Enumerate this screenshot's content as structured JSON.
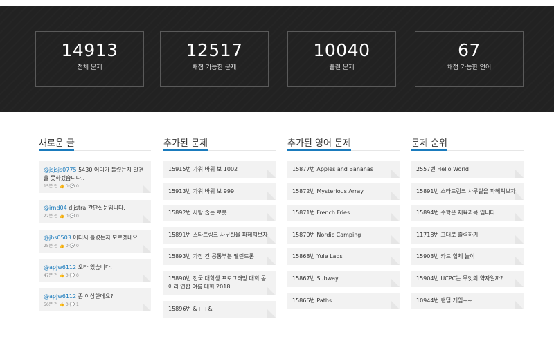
{
  "stats": [
    {
      "value": "14913",
      "label": "전체 문제"
    },
    {
      "value": "12517",
      "label": "채점 가능한 문제"
    },
    {
      "value": "10040",
      "label": "풀린 문제"
    },
    {
      "value": "67",
      "label": "채점 가능한 언어"
    }
  ],
  "new_posts": {
    "title": "새로운 글",
    "items": [
      {
        "user": "@jsjsjs0775",
        "text": " 5430 어디가 틀렸는지 발견을 못하겠습니다..",
        "meta": "15분 전 👍 0 💬 0"
      },
      {
        "user": "@irnd04",
        "text": " dijstra 간단질문입니다.",
        "meta": "22분 전 👍 0 💬 0"
      },
      {
        "user": "@jhs0503",
        "text": " 어디서 틀렸는지 모르겠네요",
        "meta": "25분 전 👍 0 💬 0"
      },
      {
        "user": "@apjw6112",
        "text": " 오타 있습니다.",
        "meta": "47분 전 👍 0 💬 0"
      },
      {
        "user": "@apjw6112",
        "text": " 좀 이상한데요?",
        "meta": "56분 전 👍 0 💬 1"
      }
    ]
  },
  "added_problems": {
    "title": "추가된 문제",
    "items": [
      "15915번 가위 바위 보 1002",
      "15913번 가위 바위 보 999",
      "15892번 사탕 줍는 로봇",
      "15891번 스타트링크 사무실을 파헤쳐보자",
      "15893번 가장 긴 공통부분 팰린드롬",
      "15890번 전국 대학생 프로그래밍 대회 동아리 연합 여름 대회 2018",
      "15896번 &+ +&"
    ]
  },
  "added_english": {
    "title": "추가된 영어 문제",
    "items": [
      "15877번 Apples and Bananas",
      "15872번 Mysterious Array",
      "15871번 French Fries",
      "15870번 Nordic Camping",
      "15868번 Yule Lads",
      "15867번 Subway",
      "15866번 Paths"
    ]
  },
  "problem_ranking": {
    "title": "문제 순위",
    "items": [
      "2557번 Hello World",
      "15891번 스타트링크 사무실을 파헤쳐보자",
      "15894번 수학은 체육과목 입니다",
      "11718번 그대로 출력하기",
      "15903번 카드 합체 놀이",
      "15904번 UCPC는 무엇의 약자일까?",
      "10944번 랜덤 게임~~"
    ]
  }
}
